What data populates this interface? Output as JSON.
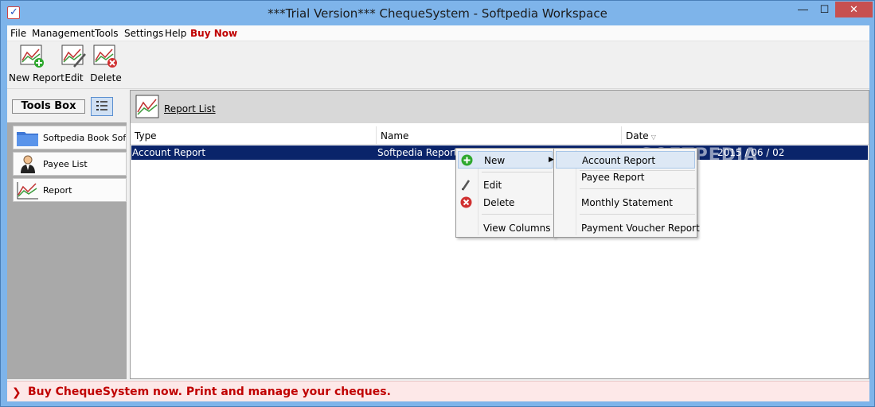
{
  "window": {
    "title": "***Trial Version*** ChequeSystem - Softpedia Workspace",
    "minimize": "—",
    "maximize": "☐",
    "close": "✕"
  },
  "menu": {
    "items": [
      "File",
      "Management",
      "Tools",
      "Settings",
      "Help"
    ],
    "buy_now": "Buy Now"
  },
  "toolbar": {
    "new_report": "New Report",
    "edit": "Edit",
    "delete": "Delete"
  },
  "tools_box": {
    "title": "Tools Box",
    "items": [
      {
        "label": "Softpedia Book Softpedia",
        "icon": "folder-icon"
      },
      {
        "label": "Payee List",
        "icon": "person-icon"
      },
      {
        "label": "Report",
        "icon": "chart-icon"
      }
    ]
  },
  "main": {
    "header_label": "Report List",
    "columns": [
      "Type",
      "Name",
      "Date"
    ],
    "rows": [
      {
        "type": "Account Report",
        "name": "Softpedia Report",
        "date": "2015 / 06 / 02"
      }
    ]
  },
  "context_menu": {
    "new": "New",
    "edit": "Edit",
    "delete": "Delete",
    "view_columns": "View Columns"
  },
  "submenu": {
    "items": [
      "Account Report",
      "Payee Report",
      "Monthly Statement",
      "Payment Voucher Report"
    ]
  },
  "watermark": "SOFTPEDIA",
  "status": {
    "text": "Buy ChequeSystem now. Print and manage your cheques."
  }
}
